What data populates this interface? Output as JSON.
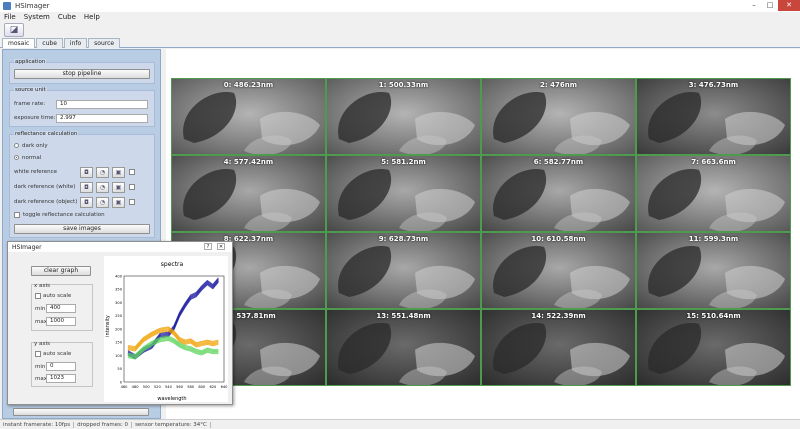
{
  "window": {
    "title": "HSImager",
    "min": "–",
    "max": "□",
    "close": "✕"
  },
  "menu": [
    "File",
    "System",
    "Cube",
    "Help"
  ],
  "tabs": [
    "mosaic",
    "cube",
    "info",
    "source"
  ],
  "application": {
    "title": "application",
    "stop_label": "stop pipeline"
  },
  "source_unit": {
    "title": "source unit",
    "frame_rate_label": "frame rate:",
    "frame_rate": "10",
    "exposure_label": "exposure time:",
    "exposure": "2.997"
  },
  "reflectance": {
    "title": "reflectance calculation",
    "dark_only": "dark only",
    "normal": "normal",
    "white_ref": "white reference",
    "dark_white": "dark reference (white)",
    "dark_object": "dark reference (object)",
    "toggle": "toggle reflectance calculation",
    "save": "save images"
  },
  "mosaic": {
    "tiles": [
      "0: 486.23nm",
      "1: 500.33nm",
      "2: 476nm",
      "3: 476.73nm",
      "4: 577.42nm",
      "5: 581.2nm",
      "6: 582.77nm",
      "7: 663.6nm",
      "8: 622.37nm",
      "9: 628.73nm",
      "10: 610.58nm",
      "11: 599.3nm",
      "12: 537.81nm",
      "13: 551.48nm",
      "14: 522.39nm",
      "15: 510.64nm"
    ]
  },
  "spectra_window": {
    "title": "HSImager",
    "help": "?",
    "close": "✕",
    "clear_label": "clear graph",
    "x_axis": "x axis",
    "y_axis": "y axis",
    "auto_scale": "auto scale",
    "min_label": "min:",
    "max_label": "max:",
    "x_min": "400",
    "x_max": "1000",
    "y_min": "0",
    "y_max": "1023"
  },
  "chart_data": {
    "type": "line",
    "title": "spectra",
    "xlabel": "wavelength",
    "ylabel": "intensity",
    "xlim": [
      460,
      640
    ],
    "ylim": [
      0,
      400
    ],
    "xticks": [
      460,
      480,
      500,
      520,
      540,
      560,
      580,
      600,
      620,
      640
    ],
    "yticks": [
      0,
      50,
      100,
      150,
      200,
      250,
      300,
      350,
      400
    ],
    "series": [
      {
        "name": "",
        "color": "#1a1aa0",
        "x": [
          467,
          480,
          495,
          510,
          525,
          540,
          550,
          560,
          570,
          580,
          590,
          600,
          610,
          620,
          630
        ],
        "values": [
          110,
          95,
          120,
          135,
          175,
          180,
          205,
          255,
          290,
          320,
          330,
          355,
          375,
          360,
          385
        ]
      },
      {
        "name": "",
        "color": "#f0a000",
        "x": [
          467,
          480,
          495,
          510,
          525,
          540,
          550,
          560,
          570,
          580,
          590,
          600,
          610,
          620,
          630
        ],
        "values": [
          130,
          125,
          160,
          180,
          195,
          200,
          185,
          160,
          150,
          155,
          140,
          145,
          150,
          145,
          150
        ]
      },
      {
        "name": "",
        "color": "#5bd45b",
        "x": [
          467,
          480,
          495,
          510,
          525,
          540,
          550,
          560,
          570,
          580,
          590,
          600,
          610,
          620,
          630
        ],
        "values": [
          100,
          95,
          125,
          145,
          160,
          165,
          155,
          140,
          130,
          125,
          115,
          110,
          120,
          115,
          115
        ]
      }
    ]
  },
  "status": {
    "frame_rate": "instant framerate: 10fps",
    "dropped": "dropped frames: 0",
    "temperature": "sensor temperature: 34°C"
  },
  "colors": {
    "panel": "#b8cce4",
    "tile_border": "#4e9a4e",
    "accent": "#c8463b"
  }
}
